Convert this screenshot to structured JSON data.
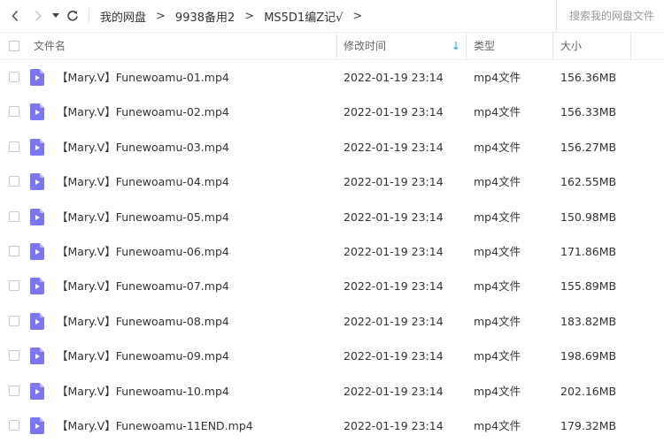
{
  "breadcrumb": [
    "我的网盘",
    "9938备用2",
    "MS5D1编Z记√"
  ],
  "breadcrumb_sep": ">",
  "search": {
    "placeholder": "搜索我的网盘文件"
  },
  "columns": {
    "name": "文件名",
    "modified": "修改时间",
    "type": "类型",
    "size": "大小"
  },
  "sort_indicator": "↓",
  "files": [
    {
      "name": "【Mary.V】Funewoamu-01.mp4",
      "modified": "2022-01-19 23:14",
      "type": "mp4文件",
      "size": "156.36MB"
    },
    {
      "name": "【Mary.V】Funewoamu-02.mp4",
      "modified": "2022-01-19 23:14",
      "type": "mp4文件",
      "size": "156.33MB"
    },
    {
      "name": "【Mary.V】Funewoamu-03.mp4",
      "modified": "2022-01-19 23:14",
      "type": "mp4文件",
      "size": "156.27MB"
    },
    {
      "name": "【Mary.V】Funewoamu-04.mp4",
      "modified": "2022-01-19 23:14",
      "type": "mp4文件",
      "size": "162.55MB"
    },
    {
      "name": "【Mary.V】Funewoamu-05.mp4",
      "modified": "2022-01-19 23:14",
      "type": "mp4文件",
      "size": "150.98MB"
    },
    {
      "name": "【Mary.V】Funewoamu-06.mp4",
      "modified": "2022-01-19 23:14",
      "type": "mp4文件",
      "size": "171.86MB"
    },
    {
      "name": "【Mary.V】Funewoamu-07.mp4",
      "modified": "2022-01-19 23:14",
      "type": "mp4文件",
      "size": "155.89MB"
    },
    {
      "name": "【Mary.V】Funewoamu-08.mp4",
      "modified": "2022-01-19 23:14",
      "type": "mp4文件",
      "size": "183.82MB"
    },
    {
      "name": "【Mary.V】Funewoamu-09.mp4",
      "modified": "2022-01-19 23:14",
      "type": "mp4文件",
      "size": "198.69MB"
    },
    {
      "name": "【Mary.V】Funewoamu-10.mp4",
      "modified": "2022-01-19 23:14",
      "type": "mp4文件",
      "size": "202.16MB"
    },
    {
      "name": "【Mary.V】Funewoamu-11END.mp4",
      "modified": "2022-01-19 23:14",
      "type": "mp4文件",
      "size": "179.32MB"
    }
  ],
  "icons": {
    "back": "chevron-left-icon",
    "forward": "chevron-right-icon",
    "history": "caret-down-icon",
    "refresh": "refresh-icon",
    "file": "video-file-icon"
  },
  "colors": {
    "accent": "#06a7ff",
    "file_icon": "#7b76f2",
    "file_icon_fold": "#b7b3f8",
    "text": "#333333"
  }
}
